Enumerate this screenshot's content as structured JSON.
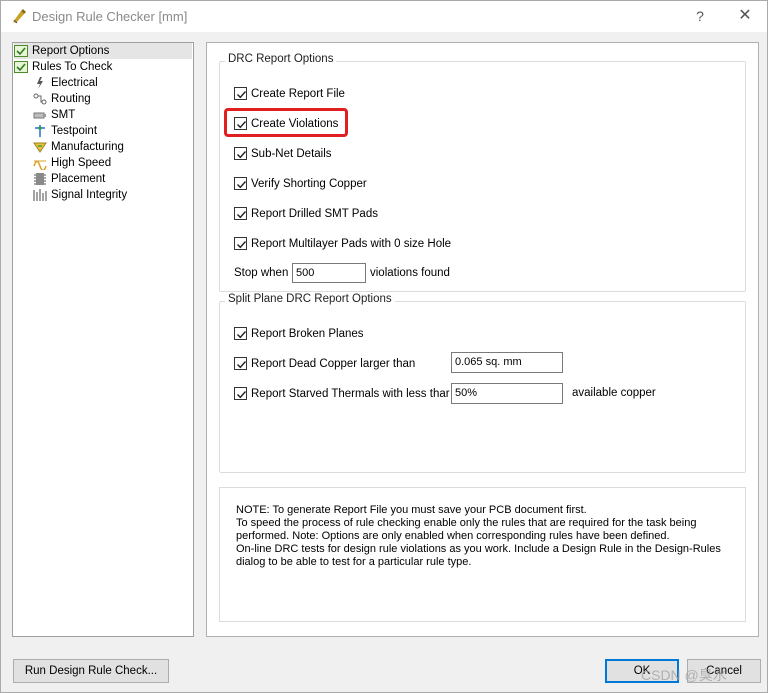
{
  "window": {
    "title": "Design Rule Checker [mm]",
    "help_button": "?",
    "close_button": "✕"
  },
  "tree": {
    "items": [
      {
        "label": "Report Options",
        "icon": "report-options-icon",
        "level": 0,
        "selected": true
      },
      {
        "label": "Rules To Check",
        "icon": "rules-to-check-icon",
        "level": 0
      },
      {
        "label": "Electrical",
        "icon": "electrical-icon",
        "level": 1
      },
      {
        "label": "Routing",
        "icon": "routing-icon",
        "level": 1
      },
      {
        "label": "SMT",
        "icon": "smt-icon",
        "level": 1
      },
      {
        "label": "Testpoint",
        "icon": "testpoint-icon",
        "level": 1
      },
      {
        "label": "Manufacturing",
        "icon": "manufacturing-icon",
        "level": 1
      },
      {
        "label": "High Speed",
        "icon": "high-speed-icon",
        "level": 1
      },
      {
        "label": "Placement",
        "icon": "placement-icon",
        "level": 1
      },
      {
        "label": "Signal Integrity",
        "icon": "signal-integrity-icon",
        "level": 1
      }
    ]
  },
  "drc_options": {
    "title": "DRC Report Options",
    "checkboxes": [
      {
        "label": "Create Report File",
        "checked": true
      },
      {
        "label": "Create Violations",
        "checked": true
      },
      {
        "label": "Sub-Net Details",
        "checked": true
      },
      {
        "label": "Verify Shorting Copper",
        "checked": true
      },
      {
        "label": "Report Drilled SMT Pads",
        "checked": true
      },
      {
        "label": "Report Multilayer Pads with 0 size Hole",
        "checked": true
      }
    ],
    "stop_label": "Stop when",
    "stop_value": "500",
    "stop_suffix": "violations found"
  },
  "split_plane": {
    "title": "Split Plane DRC Report Options",
    "broken_planes": "Report Broken Planes",
    "dead_copper_label": "Report Dead Copper larger than",
    "dead_copper_value": "0.065 sq. mm",
    "starved_label": "Report Starved Thermals with less thar",
    "starved_value": "50%",
    "starved_suffix": "available copper"
  },
  "note": "NOTE: To generate Report File you must save your PCB document first.\nTo speed the process of rule checking enable only the rules that are required for the task being performed.  Note: Options are only enabled when corresponding rules have been defined.\nOn-line DRC tests for design rule violations as you work. Include a Design Rule in the Design-Rules dialog to be able to test for a particular rule  type.",
  "buttons": {
    "run": "Run Design Rule Check...",
    "ok": "OK",
    "cancel": "Cancel"
  },
  "watermark": "CSDN @臭水",
  "colors": {
    "highlight": "#e02020",
    "ok_border": "#0078d7"
  }
}
